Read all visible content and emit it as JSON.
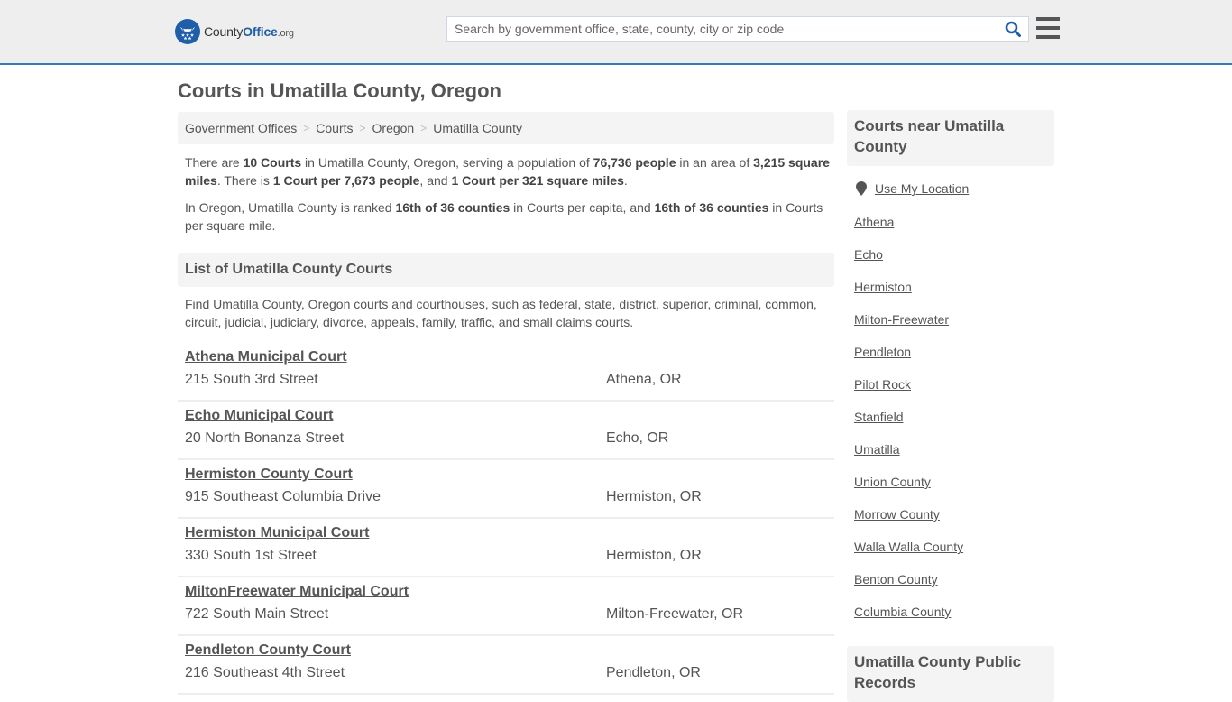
{
  "header": {
    "logo": {
      "prefix": "County",
      "brand": "Office",
      "suffix": ".org"
    },
    "search": {
      "placeholder": "Search by government office, state, county, city or zip code",
      "value": ""
    },
    "colors": {
      "brand": "#1f5ea8",
      "accent_border": "#337ab7",
      "header_bg": "#eeeeee"
    }
  },
  "page": {
    "title": "Courts in Umatilla County, Oregon"
  },
  "breadcrumb": [
    "Government Offices",
    "Courts",
    "Oregon",
    "Umatilla County"
  ],
  "summary": {
    "p1": {
      "t1": "There are ",
      "b1": "10 Courts",
      "t2": " in Umatilla County, Oregon, serving a population of ",
      "b2": "76,736 people",
      "t3": " in an area of ",
      "b3": "3,215 square miles",
      "t4": ". There is ",
      "b4": "1 Court per 7,673 people",
      "t5": ", and ",
      "b5": "1 Court per 321 square miles",
      "t6": "."
    },
    "p2": {
      "t1": "In Oregon, Umatilla County is ranked ",
      "b1": "16th of 36 counties",
      "t2": " in Courts per capita, and ",
      "b2": "16th of 36 counties",
      "t3": " in Courts per square mile."
    }
  },
  "list": {
    "heading": "List of Umatilla County Courts",
    "description": "Find Umatilla County, Oregon courts and courthouses, such as federal, state, district, superior, criminal, common, circuit, judicial, judiciary, divorce, appeals, family, traffic, and small claims courts.",
    "courts": [
      {
        "name": "Athena Municipal Court",
        "address": "215 South 3rd Street",
        "city": "Athena, OR"
      },
      {
        "name": "Echo Municipal Court",
        "address": "20 North Bonanza Street",
        "city": "Echo, OR"
      },
      {
        "name": "Hermiston County Court",
        "address": "915 Southeast Columbia Drive",
        "city": "Hermiston, OR"
      },
      {
        "name": "Hermiston Municipal Court",
        "address": "330 South 1st Street",
        "city": "Hermiston, OR"
      },
      {
        "name": "MiltonFreewater Municipal Court",
        "address": "722 South Main Street",
        "city": "Milton-Freewater, OR"
      },
      {
        "name": "Pendleton County Court",
        "address": "216 Southeast 4th Street",
        "city": "Pendleton, OR"
      }
    ]
  },
  "sidebar": {
    "near_heading": "Courts near Umatilla County",
    "use_location": "Use My Location",
    "near_links": [
      "Athena",
      "Echo",
      "Hermiston",
      "Milton-Freewater",
      "Pendleton",
      "Pilot Rock",
      "Stanfield",
      "Umatilla",
      "Union County",
      "Morrow County",
      "Walla Walla County",
      "Benton County",
      "Columbia County"
    ],
    "records_heading": "Umatilla County Public Records"
  }
}
